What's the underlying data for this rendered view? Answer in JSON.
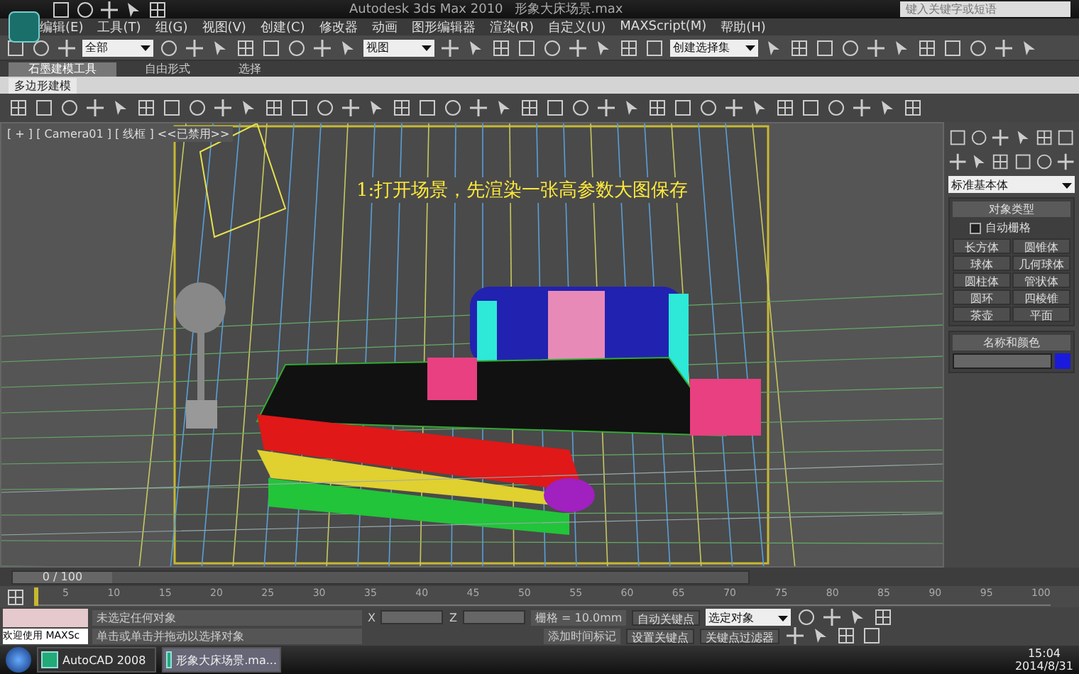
{
  "title_bar": {
    "app_title": "Autodesk 3ds Max  2010",
    "file_name": "形象大床场景.max",
    "search": {
      "placeholder": "键入关键字或短语"
    }
  },
  "menu": [
    "编辑(E)",
    "工具(T)",
    "组(G)",
    "视图(V)",
    "创建(C)",
    "修改器",
    "动画",
    "图形编辑器",
    "渲染(R)",
    "自定义(U)",
    "MAXScript(M)",
    "帮助(H)"
  ],
  "main_toolbar": {
    "selection_filter": "全部",
    "reference_coord": "视图",
    "named_selection": "创建选择集"
  },
  "ribbon": {
    "tabs": [
      {
        "label": "石墨建模工具",
        "selected": true
      },
      {
        "label": "自由形式",
        "selected": false
      },
      {
        "label": "选择",
        "selected": false
      }
    ],
    "panel_title": "多边形建模"
  },
  "viewport": {
    "label": "[ + ] [ Camera01 ] [ 线框 ] <<已禁用>>",
    "annotation": "1:打开场景，先渲染一张高参数大图保存"
  },
  "command_panel": {
    "category": "标准基本体",
    "object_type": {
      "title": "对象类型",
      "auto_grid": {
        "label": "自动栅格",
        "checked": false
      },
      "buttons": [
        "长方体",
        "圆锥体",
        "球体",
        "几何球体",
        "圆柱体",
        "管状体",
        "圆环",
        "四棱锥",
        "茶壶",
        "平面"
      ]
    },
    "name_color": {
      "title": "名称和颜色",
      "color": "#1a1adc"
    }
  },
  "timeline": {
    "frame": "0 / 100",
    "level": 0,
    "ticks": [
      "5",
      "10",
      "15",
      "20",
      "25",
      "30",
      "35",
      "40",
      "45",
      "50",
      "55",
      "60",
      "65",
      "70",
      "75",
      "80",
      "85",
      "90",
      "95",
      "100"
    ]
  },
  "status": {
    "script_label": "欢迎使用  MAXSc",
    "prompt": "未选定任何对象",
    "hint": "单击或单击并拖动以选择对象",
    "x_label": "X",
    "z_label": "Z",
    "grid": "栅格 = 10.0mm",
    "add_time_tag": "添加时间标记",
    "auto_key": "自动关键点",
    "set_key": "设置关键点",
    "key_mode": "选定对象",
    "key_filters": "关键点过滤器"
  },
  "taskbar": {
    "items": [
      {
        "label": "AutoCAD 2008",
        "selected": false
      },
      {
        "label": "形象大床场景.ma...",
        "selected": true
      }
    ],
    "time": "15:04",
    "date": "2014/8/31"
  }
}
